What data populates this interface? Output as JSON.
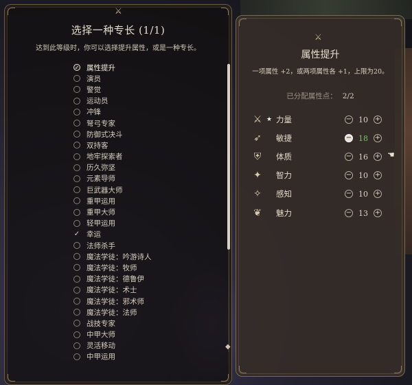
{
  "left_panel": {
    "title": "选择一种专长 (1/1)",
    "description": "达到此等级时，你可以选择提升属性，或是一种专长。",
    "feats": [
      {
        "label": "属性提升",
        "state": "checked"
      },
      {
        "label": "演员",
        "state": "none"
      },
      {
        "label": "警觉",
        "state": "none"
      },
      {
        "label": "运动员",
        "state": "none"
      },
      {
        "label": "冲锋",
        "state": "none"
      },
      {
        "label": "弩弓专家",
        "state": "none"
      },
      {
        "label": "防御式决斗",
        "state": "none"
      },
      {
        "label": "双持客",
        "state": "none"
      },
      {
        "label": "地牢探索者",
        "state": "none"
      },
      {
        "label": "历久弥坚",
        "state": "none"
      },
      {
        "label": "元素导师",
        "state": "none"
      },
      {
        "label": "巨武器大师",
        "state": "none"
      },
      {
        "label": "重甲运用",
        "state": "none"
      },
      {
        "label": "重甲大师",
        "state": "none"
      },
      {
        "label": "轻甲运用",
        "state": "none"
      },
      {
        "label": "幸运",
        "state": "tick"
      },
      {
        "label": "法师杀手",
        "state": "none"
      },
      {
        "label": "魔法学徒：吟游诗人",
        "state": "none"
      },
      {
        "label": "魔法学徒：牧师",
        "state": "none"
      },
      {
        "label": "魔法学徒：德鲁伊",
        "state": "none"
      },
      {
        "label": "魔法学徒：术士",
        "state": "none"
      },
      {
        "label": "魔法学徒：邪术师",
        "state": "none"
      },
      {
        "label": "魔法学徒：法师",
        "state": "none"
      },
      {
        "label": "战技专家",
        "state": "none"
      },
      {
        "label": "中甲大师",
        "state": "none"
      },
      {
        "label": "灵活移动",
        "state": "none"
      },
      {
        "label": "中甲运用",
        "state": "none"
      }
    ]
  },
  "right_panel": {
    "title": "属性提升",
    "description": "一项属性 +2，或两项属性各 +1，上限为20。",
    "points_label": "已分配属性点：",
    "points_value": "2/2",
    "abilities": [
      {
        "name": "力量",
        "value": "10",
        "icon": "strength-icon",
        "glyph": "⚔",
        "starred": true,
        "raised": false
      },
      {
        "name": "敏捷",
        "value": "18",
        "icon": "dexterity-icon",
        "glyph": "➶",
        "starred": false,
        "raised": true
      },
      {
        "name": "体质",
        "value": "16",
        "icon": "constitution-icon",
        "glyph": "⛨",
        "starred": false,
        "raised": false
      },
      {
        "name": "智力",
        "value": "10",
        "icon": "intelligence-icon",
        "glyph": "✦",
        "starred": false,
        "raised": false
      },
      {
        "name": "感知",
        "value": "10",
        "icon": "wisdom-icon",
        "glyph": "✧",
        "starred": false,
        "raised": false
      },
      {
        "name": "魅力",
        "value": "13",
        "icon": "charisma-icon",
        "glyph": "❦",
        "starred": false,
        "raised": false
      }
    ]
  },
  "icons": {
    "title_ornament": "crossed-swords-icon",
    "star": "star-icon",
    "checkmark": "checkmark-icon",
    "cursor": "gauntlet-cursor-icon"
  },
  "colors": {
    "raised_value": "#7cc26a",
    "panel_border": "#6a5a44",
    "text": "#e2d9c8"
  }
}
